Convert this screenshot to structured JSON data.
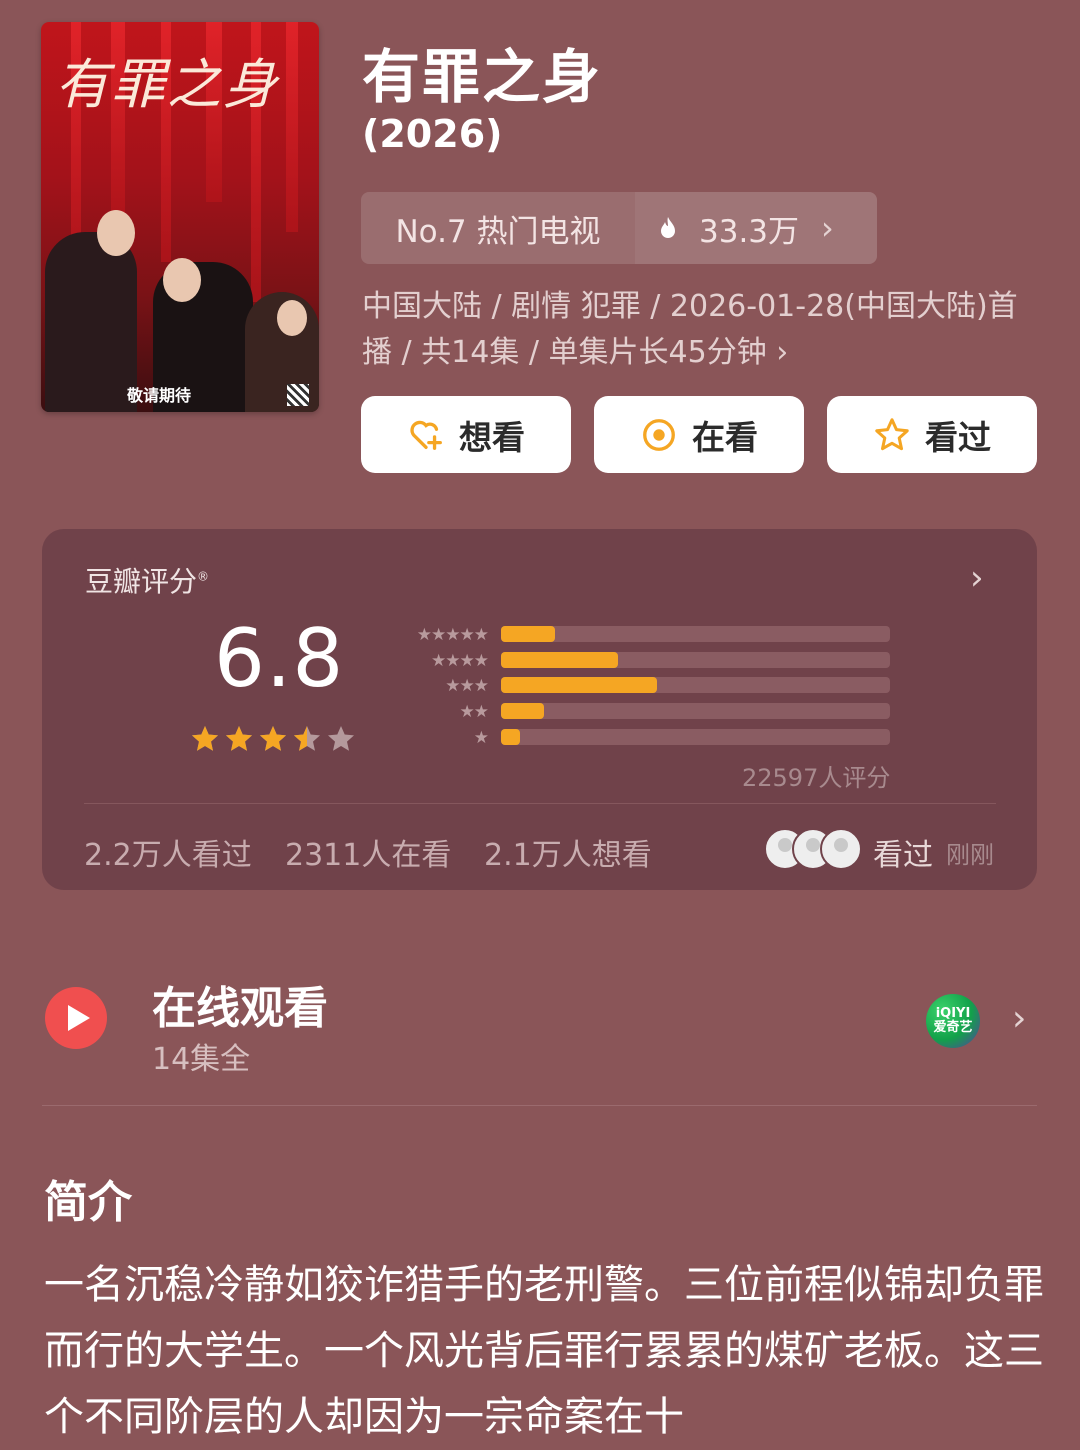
{
  "poster": {
    "title_art": "有罪之身",
    "tagline": "敬请期待"
  },
  "title": "有罪之身",
  "year": "(2026)",
  "rank": {
    "label": "No.7 热门电视",
    "heat": "33.3万"
  },
  "meta": {
    "line1": "中国大陆 / 剧情 犯罪 / 2026-01-28(中国大陆)首",
    "line2": "播 / 共14集 / 单集片长45分钟"
  },
  "actions": [
    {
      "label": "想看",
      "icon": "heart-plus-icon"
    },
    {
      "label": "在看",
      "icon": "target-circle-icon"
    },
    {
      "label": "看过",
      "icon": "star-outline-icon"
    }
  ],
  "rating": {
    "label": "豆瓣评分",
    "score": "6.8",
    "stars": 3.5,
    "distribution_percent": [
      14,
      30,
      40,
      11,
      5
    ],
    "count": "22597人评分",
    "stats": [
      "2.2万人看过",
      "2311人在看",
      "2.1万人想看"
    ],
    "friends_action": "看过",
    "friends_time": "刚刚"
  },
  "online": {
    "title": "在线观看",
    "episodes": "14集全",
    "platform": "iQIYI爱奇艺",
    "platform_top": "iQIYI",
    "platform_bottom": "爱奇艺"
  },
  "intro": {
    "heading": "简介",
    "text": "一名沉稳冷静如狡诈猎手的老刑警。三位前程似锦却负罪而行的大学生。一个风光背后罪行累累的煤矿老板。这三个不同阶层的人却因为一宗命案在十"
  },
  "colors": {
    "background": "#8a5558",
    "card": "#70424a",
    "accent": "#f5a623",
    "play": "#f04f4f"
  }
}
